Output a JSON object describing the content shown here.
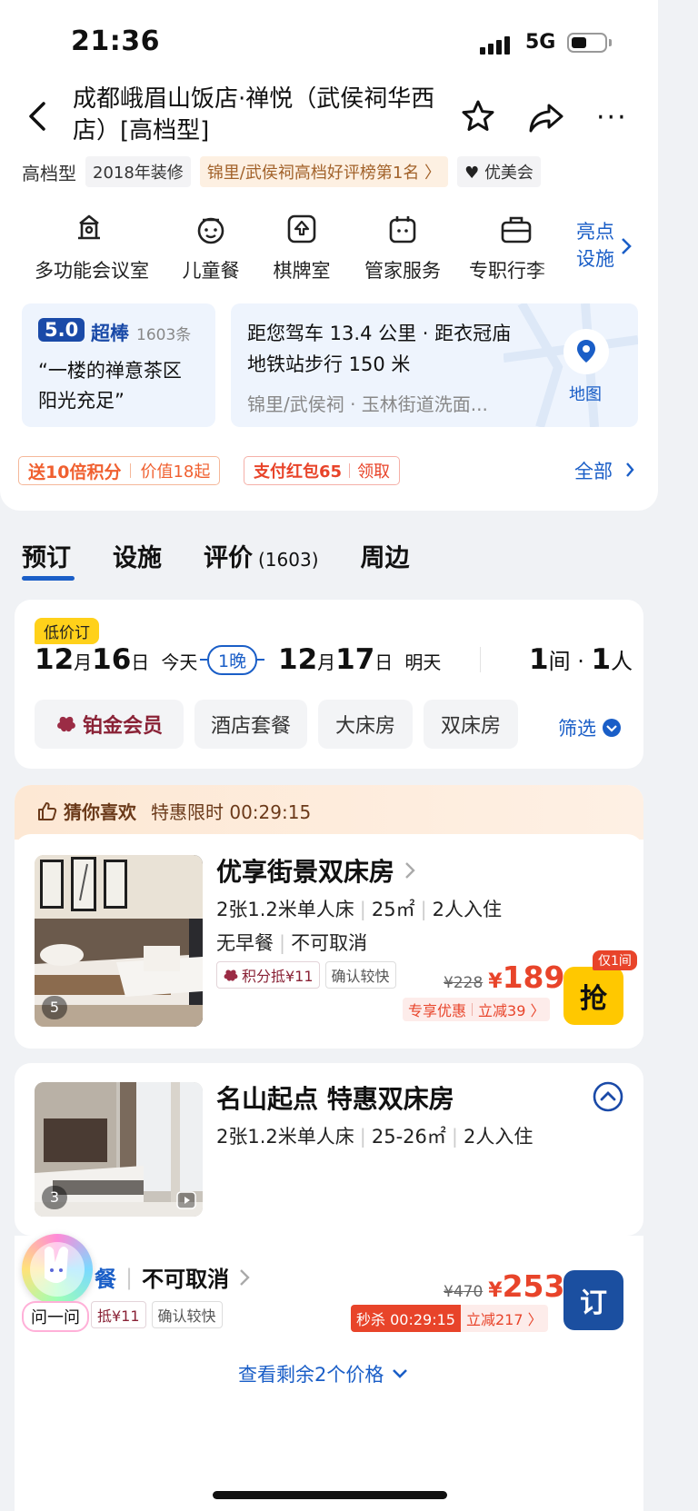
{
  "status": {
    "time": "21:36",
    "network": "5G"
  },
  "header": {
    "title": "成都峨眉山饭店·禅悦（武侯祠华西店）[高档型]"
  },
  "tags": {
    "grade": "高档型",
    "renovation": "2018年装修",
    "rank": "锦里/武侯祠高档好评榜第1名 〉",
    "vip": "优美会"
  },
  "facilities": [
    {
      "label": "多功能会议室",
      "icon": "meeting-room-icon"
    },
    {
      "label": "儿童餐",
      "icon": "kids-meal-icon"
    },
    {
      "label": "棋牌室",
      "icon": "chess-room-icon"
    },
    {
      "label": "管家服务",
      "icon": "butler-icon"
    },
    {
      "label": "专职行李",
      "icon": "luggage-icon"
    }
  ],
  "highlight": {
    "line1": "亮点",
    "line2": "设施"
  },
  "review": {
    "score": "5.0",
    "level": "超棒",
    "count": "1603条",
    "quote_line1": "“一楼的禅意茶区",
    "quote_line2": "阳光充足”"
  },
  "location": {
    "line1": "距您驾车 13.4 公里 · 距衣冠庙",
    "line2": "地铁站步行 150 米",
    "line3": "锦里/武侯祠 · 玉林街道洗面...",
    "map_label": "地图"
  },
  "promos": {
    "points_bold": "送10倍积分",
    "points_value": "价值18起",
    "redpack": "支付红包65",
    "redpack_action": "领取",
    "all": "全部"
  },
  "tabs": [
    {
      "label": "预订"
    },
    {
      "label": "设施"
    },
    {
      "label": "评价",
      "count": "(1603)"
    },
    {
      "label": "周边"
    }
  ],
  "booking": {
    "badge": "低价订",
    "checkin_month": "12",
    "checkin_day": "16",
    "checkin_note": "今天",
    "nights": "1晚",
    "checkout_month": "12",
    "checkout_day": "17",
    "checkout_note": "明天",
    "rooms": "1",
    "people": "1",
    "filters": [
      "铂金会员",
      "酒店套餐",
      "大床房",
      "双床房"
    ],
    "filter_action": "筛选"
  },
  "guess": {
    "title": "猜你喜欢",
    "timer": "特惠限时 00:29:15"
  },
  "room1": {
    "name": "优享街景双床房",
    "beds": "2张1.2米单人床",
    "area": "25㎡",
    "guests": "2人入住",
    "breakfast": "无早餐",
    "cancel": "不可取消",
    "points_tag": "积分抵¥11",
    "confirm_tag": "确认较快",
    "photo_count": "5",
    "old_price": "¥228",
    "currency": "¥",
    "price": "189",
    "perk": "专享优惠",
    "discount": "立减39 〉",
    "badge": "仅1间",
    "button": "抢"
  },
  "room2": {
    "name": "名山起点 特惠双床房",
    "beds": "2张1.2米单人床",
    "area": "25-26㎡",
    "guests": "2人入住",
    "photo_count": "3",
    "sub_breakfast": "餐",
    "sub_cancel": "不可取消",
    "points_tag": "抵¥11",
    "confirm_tag": "确认较快",
    "old_price": "¥470",
    "currency": "¥",
    "price": "253",
    "flash": "秒杀 00:29:15",
    "discount": "立减217 〉",
    "button": "订",
    "more_prices": "查看剩余2个价格"
  },
  "assistant": {
    "label": "问一问"
  }
}
